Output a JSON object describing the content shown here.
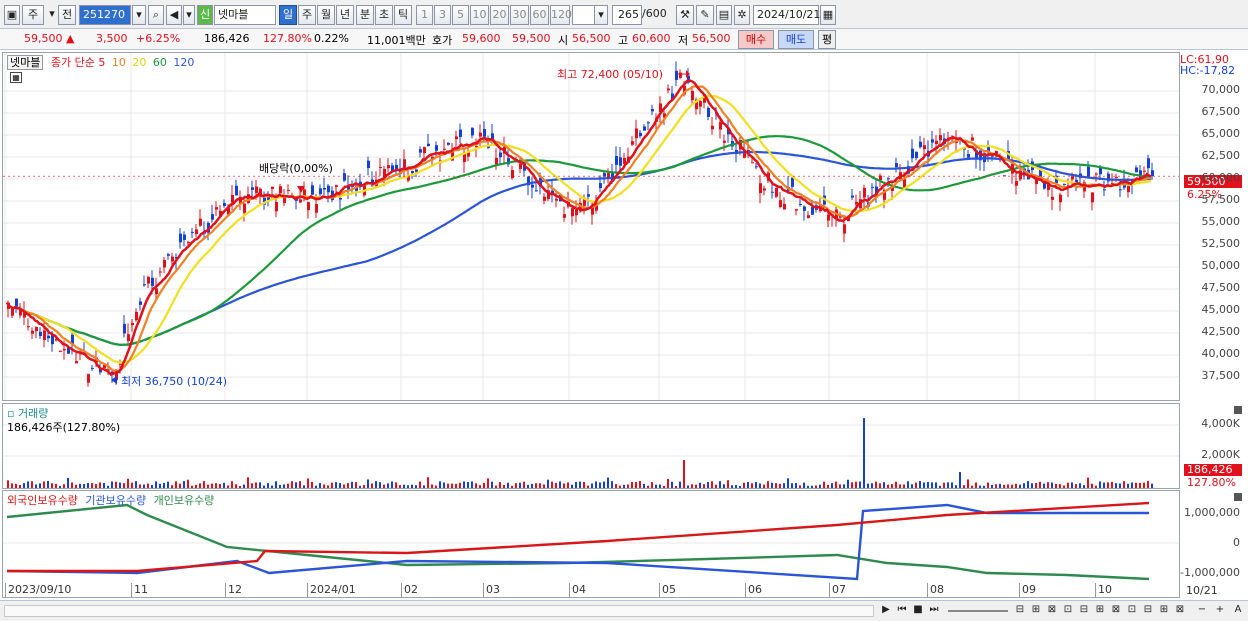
{
  "toolbar": {
    "period_mode": "주",
    "prev_label": "전",
    "code": "251270",
    "stock_name": "넷마블",
    "new_badge": "신",
    "period_buttons": [
      "일",
      "주",
      "월",
      "년",
      "분",
      "초",
      "틱"
    ],
    "interval_buttons": [
      "1",
      "3",
      "5",
      "10",
      "20",
      "30",
      "60",
      "120"
    ],
    "count_value": "265",
    "count_max": "/600",
    "date": "2024/10/21"
  },
  "quote": {
    "price": "59,500",
    "up_arrow": "▲",
    "change": "3,500",
    "change_pct": "+6.25%",
    "volume": "186,426",
    "volume_ratio": "127.80%",
    "turnover_pct": "0.22%",
    "trade_value": "11,001백만",
    "bid_label": "호가",
    "bid1": "59,600",
    "bid2": "59,500",
    "open_label": "시",
    "open": "56,500",
    "high_label": "고",
    "high": "60,600",
    "low_label": "저",
    "low": "56,500",
    "buy_label": "매수",
    "sell_label": "매도",
    "eval_label": "평"
  },
  "price_pane": {
    "legend_name": "넷마블",
    "legend_ma": "종가 단순",
    "ma_periods": [
      "5",
      "10",
      "20",
      "60",
      "120"
    ],
    "ma_colors": [
      "#e0101c",
      "#f08020",
      "#f0e020",
      "#1c9a3a",
      "#2a55d8"
    ],
    "lc_label": "LC:61,90",
    "hc_label": "HC:-17,82",
    "high_annotation": "최고 72,400 (05/10)",
    "low_annotation": "최저 36,750 (10/24)",
    "dividend_annotation": "배당락(0,00%)",
    "current_price_tag": "59,500",
    "current_pct_tag": "6.25%",
    "y_ticks": [
      "70,000",
      "67,500",
      "65,000",
      "62,500",
      "60,000",
      "57,500",
      "55,000",
      "52,500",
      "50,000",
      "47,500",
      "45,000",
      "42,500",
      "40,000",
      "37,500"
    ]
  },
  "volume_pane": {
    "title": "거래량",
    "value_label": "186,426주(127.80%)",
    "y_ticks": [
      "4,000K",
      "2,000K"
    ],
    "current_tag": "186,426",
    "current_pct_tag": "127.80%"
  },
  "holding_pane": {
    "legend": [
      "외국인보유수량",
      "기관보유수량",
      "개인보유수량"
    ],
    "colors": [
      "#d81818",
      "#2a55d8",
      "#2f8a50"
    ],
    "y_ticks": [
      "1,000,000",
      "0",
      "-1,000,000"
    ]
  },
  "x_axis": {
    "labels": [
      "2023/09/10",
      "11",
      "12",
      "2024/01",
      "02",
      "03",
      "04",
      "05",
      "06",
      "07",
      "08",
      "09",
      "10"
    ],
    "right_label": "10/21"
  },
  "chart_data": {
    "type": "line",
    "title": "",
    "price_series_approx": {
      "x": [
        "2023/09",
        "2023/10",
        "2023/10/24",
        "2023/11",
        "2023/12",
        "2024/01",
        "2024/02",
        "2024/03",
        "2024/04",
        "2024/05/10",
        "2024/06",
        "2024/07",
        "2024/08",
        "2024/09",
        "2024/10/21"
      ],
      "close": [
        45500,
        41000,
        37000,
        46000,
        57500,
        57000,
        60000,
        64000,
        55000,
        70500,
        59000,
        54500,
        64000,
        58000,
        59500
      ]
    },
    "ylim": [
      36000,
      72500
    ],
    "max_point": {
      "date": "05/10",
      "value": 72400
    },
    "min_point": {
      "date": "10/24",
      "value": 36750
    }
  }
}
